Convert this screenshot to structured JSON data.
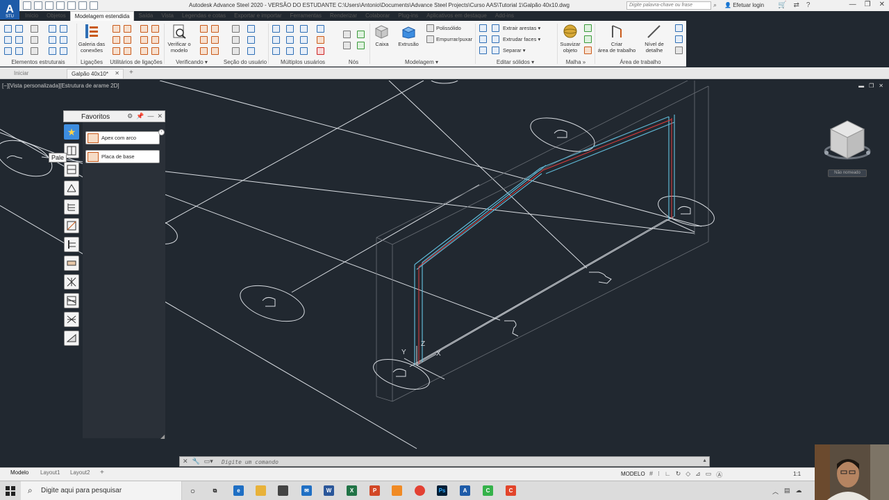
{
  "window": {
    "title": "Autodesk Advance Steel 2020 - VERSÃO DO ESTUDANTE   C:\\Users\\Antonio\\Documents\\Advance Steel Projects\\Curso AAS\\Tutorial 1\\Galpão 40x10.dwg",
    "search_placeholder": "Digite palavra-chave ou frase",
    "login_label": "Efetuar login",
    "app_logo": "A",
    "app_logo_sub": "STU"
  },
  "ribbon_tabs": [
    {
      "label": "Início"
    },
    {
      "label": "Objetos"
    },
    {
      "label": "Modelagem estendida"
    },
    {
      "label": "Saída"
    },
    {
      "label": "Vista"
    },
    {
      "label": "Legendas e cotas"
    },
    {
      "label": "Exportar e importar"
    },
    {
      "label": "Ferramentas"
    },
    {
      "label": "Renderizar"
    },
    {
      "label": "Colaborar"
    },
    {
      "label": "Plug-ins"
    },
    {
      "label": "Aplicativos em destaque"
    },
    {
      "label": "Add-ins"
    }
  ],
  "ribbon": {
    "groups": {
      "elementos": "Elementos estruturais",
      "ligacoes": "Ligações",
      "utilitarios": "Utilitários de ligações",
      "verificando": "Verificando",
      "secao": "Seção do usuário",
      "multiplos": "Múltiplos usuários",
      "nos": "Nós",
      "modelagem": "Modelagem",
      "editar": "Editar sólidos",
      "malha": "Malha",
      "area": "Área de trabalho"
    },
    "buttons": {
      "galeria_1": "Galeria das",
      "galeria_2": "conexões",
      "verificar_1": "Verificar o",
      "verificar_2": "modelo",
      "caixa": "Caixa",
      "extrusao": "Extrusão",
      "polissolido": "Polissólido",
      "empurrar": "Empurrar/puxar",
      "extrair_arestas": "Extrair arestas",
      "extrudar_faces": "Extrudar faces",
      "separar": "Separar",
      "suavizar_1": "Suavizar",
      "suavizar_2": "objeto",
      "criar_1": "Criar",
      "criar_2": "área de trabalho",
      "nivel_1": "Nível de",
      "nivel_2": "detalhe"
    }
  },
  "file_tabs": {
    "home": "Iniciar",
    "doc": "Galpão 40x10*"
  },
  "viewport": {
    "label": "[−][Vista personalizada][Estrutura de arame 2D]",
    "viewcube_name": "Não nomeado",
    "axis_x": "X",
    "axis_y": "Y",
    "axis_z": "Z"
  },
  "favoritos": {
    "title": "Favoritos",
    "tooltip": "Pale",
    "items": [
      {
        "label": "Apex com arco"
      },
      {
        "label": "Placa de base"
      }
    ]
  },
  "command": {
    "placeholder": "Digite um comando"
  },
  "layout_tabs": [
    {
      "label": "Modelo"
    },
    {
      "label": "Layout1"
    },
    {
      "label": "Layout2"
    }
  ],
  "status": {
    "model": "MODELO",
    "scale": "1:1"
  },
  "taskbar": {
    "search_text": "Digite aqui para pesquisar"
  },
  "colors": {
    "viewport_bg": "#212830",
    "accent_blue": "#2f6fb5",
    "frame_blue": "#5fb7d4",
    "frame_red": "#e23b3b"
  }
}
